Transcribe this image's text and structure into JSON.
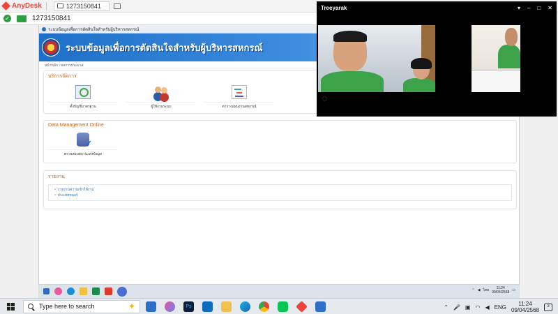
{
  "anydesk": {
    "brand": "AnyDesk",
    "tab_address": "1273150841",
    "address_bar": "1273150841"
  },
  "remote": {
    "browser_tab_title": "ระบบข้อมูลเพื่อการตัดสินใจสำหรับผู้บริหารสหกรณ์",
    "banner_title": "ระบบข้อมูลเพื่อการตัดสินใจสำหรับผู้บริหารสหกรณ์",
    "breadcrumb": "หน้าหลัก › ผลการประมวล",
    "services": {
      "heading": "บริการจัดการ",
      "items": [
        {
          "label": "ตั้งบัญชีมาตรฐาน",
          "icon": "settings-icon"
        },
        {
          "label": "ผู้ใช้งานระบบ",
          "icon": "users-icon"
        },
        {
          "label": "ตารางแผนงานสหกรณ์",
          "icon": "gantt-icon"
        }
      ]
    },
    "data_management": {
      "heading": "Data Management Online",
      "items": [
        {
          "label": "ตรวจสอบสถานะส่งข้อมูล",
          "icon": "database-check-icon"
        }
      ]
    },
    "reports": {
      "heading": "รายงาน",
      "links": [
        "รายงานความเข้าใช้งาน",
        "ประเทศหลอร์"
      ]
    },
    "taskbar": {
      "lang": "ไทย",
      "time": "11:24",
      "date": "09/04/2568"
    }
  },
  "video_call": {
    "title": "Treeyarak",
    "controls": [
      "pin-icon",
      "minimize-icon",
      "maximize-icon",
      "close-icon"
    ]
  },
  "taskbar": {
    "search_placeholder": "Type here to search",
    "lang": "ENG",
    "time": "11:24",
    "date": "09/04/2568",
    "notification_count": "3"
  }
}
